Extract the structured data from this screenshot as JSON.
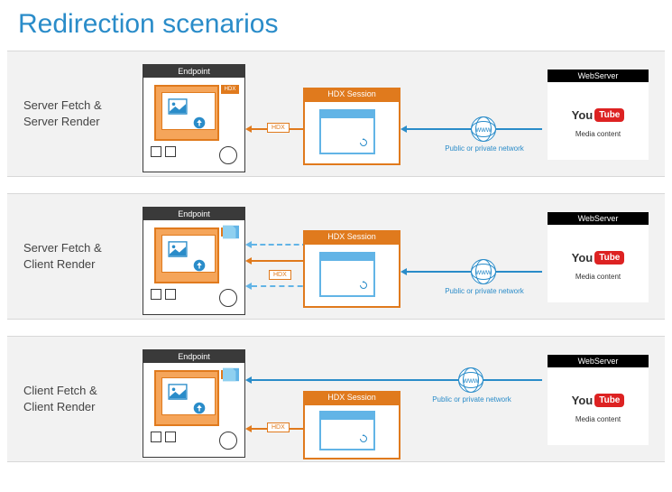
{
  "title": "Redirection scenarios",
  "network_label": "Public or private network",
  "www_label": "www",
  "hdx_tag": "HDX",
  "boxes": {
    "endpoint": "Endpoint",
    "hdx_session": "HDX Session",
    "webserver": "WebServer",
    "media": "Media content",
    "youtube_you": "You",
    "youtube_tube": "Tube"
  },
  "scenarios": [
    {
      "line1": "Server Fetch &",
      "line2": "Server Render"
    },
    {
      "line1": "Server Fetch &",
      "line2": "Client Render"
    },
    {
      "line1": "Client Fetch &",
      "line2": "Client Render"
    }
  ]
}
